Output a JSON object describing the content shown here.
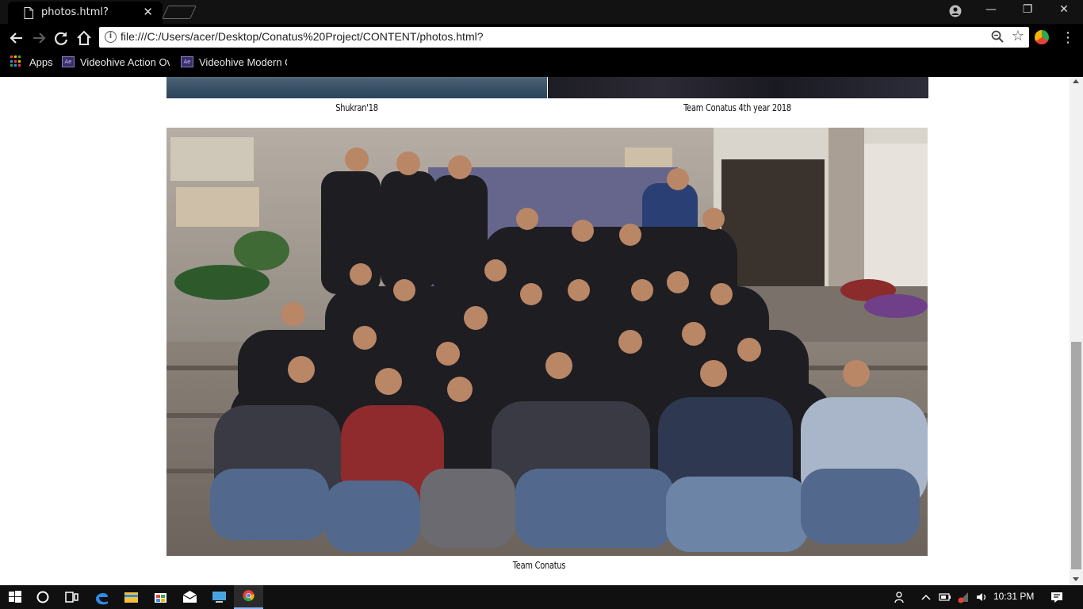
{
  "browser": {
    "tab_title": "photos.html?",
    "tab_close": "✕",
    "address": "file:///C:/Users/acer/Desktop/Conatus%20Project/CONTENT/photos.html?",
    "window_buttons": {
      "minimize": "—",
      "restore": "❐",
      "close": "✕"
    },
    "menu": "⋮",
    "bookmarks": [
      {
        "label": "Apps",
        "icon": "apps-grid-icon"
      },
      {
        "label": "Videohive Action Ove",
        "icon": "after-effects-icon"
      },
      {
        "label": "Videohive Modern Gl",
        "icon": "after-effects-icon"
      }
    ]
  },
  "page": {
    "captions": {
      "shukran": "Shukran'18",
      "team_4th_year": "Team Conatus 4th year 2018",
      "team": "Team Conatus"
    }
  },
  "taskbar": {
    "clock": "10:31 PM",
    "apps": [
      "windows-start-icon",
      "cortana-icon",
      "task-view-icon",
      "edge-icon",
      "file-explorer-icon",
      "store-icon",
      "mail-icon",
      "pc-icon",
      "chrome-icon"
    ]
  },
  "colors": {
    "chrome_dark": "#000000",
    "tab_strip": "#121212",
    "page_bg": "#ffffff",
    "taskbar": "#101010"
  }
}
